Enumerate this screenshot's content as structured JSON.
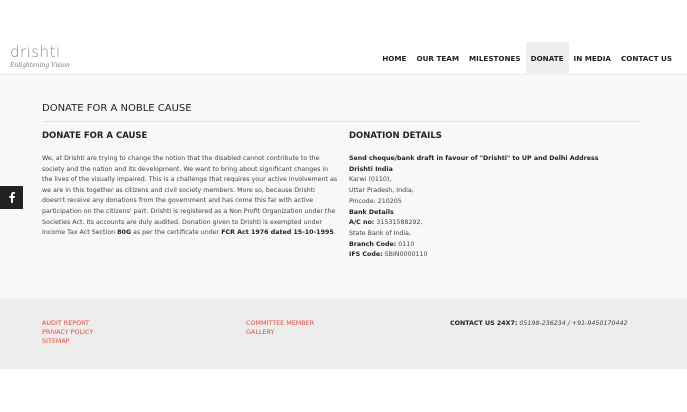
{
  "logo": {
    "name": "drishti",
    "tagline": "Enlightening Vision"
  },
  "nav": [
    {
      "label": "HOME"
    },
    {
      "label": "OUR TEAM"
    },
    {
      "label": "MILESTONES"
    },
    {
      "label": "DONATE",
      "active": true
    },
    {
      "label": "IN MEDIA"
    },
    {
      "label": "CONTACT US"
    }
  ],
  "page": {
    "title": "DONATE FOR A NOBLE CAUSE",
    "left": {
      "title": "DONATE FOR A CAUSE",
      "para_1": "We, at Drishti are trying to change the notion that the disabled cannot contribute to the society and the nation and its development. We want to bring about significant changes in the lives of the visually impaired. This is a challenge that requires your active involvement as we are in this together as citizens and civil society members. More so, because Drishti doesn't receive any donations from the government and has come this far with active participation on the citizens' part. Drishti is registered as a Non Profit Organization under the Societies Act. Its accounts are duly audited. Donation given to Drishti is exempted under Income Tax Act Section ",
      "section": "80G",
      "para_2": " as per the certificate under ",
      "fcr": "FCR Act 1976 dated 15-10-1995",
      "para_3": "."
    },
    "right": {
      "title": "DONATION DETAILS",
      "send_line": "Send cheque/bank draft in favour of \"Drishti\" to UP and Delhi Address",
      "org_name": "Drishti India",
      "address_1": "Karwi (0110),",
      "address_2": "Uttar Pradesh, India,",
      "pincode": "Pincode: 210205",
      "bank_heading": "Bank Details",
      "ac_label": "A/C no:",
      "ac_value": " 31531588292,",
      "bank_name": "State Bank of India,",
      "branch_label": "Branch Code:",
      "branch_value": " 0110",
      "ifs_label": "IFS Code:",
      "ifs_value": " SBIN0000110"
    }
  },
  "social": {
    "icon": "facebook-icon",
    "glyph": "f"
  },
  "footer": {
    "col_1": [
      "AUDIT REPORT",
      "PRIVACY POLICY",
      "SITEMAP"
    ],
    "col_2": [
      "COMMITTEE MEMBER",
      "GALLERY"
    ],
    "contact_label": "CONTACT US 24X7:",
    "contact_value": " 05198-236234 / +91-9450170442"
  },
  "colors": {
    "link": "#e34b3b",
    "footer_bg": "#ededed",
    "main_bg": "#f8f8f8"
  }
}
